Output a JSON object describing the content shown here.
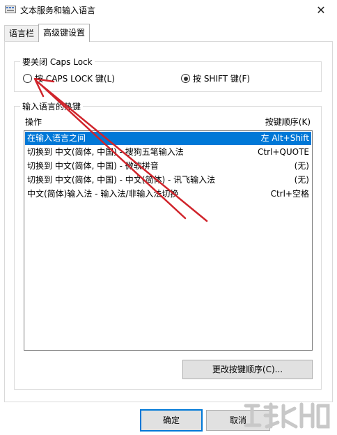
{
  "window": {
    "title": "文本服务和输入语言"
  },
  "tabs": [
    {
      "label": "语言栏"
    },
    {
      "label": "高级键设置"
    }
  ],
  "caps_group": {
    "legend": "要关闭 Caps Lock",
    "option_caps": "按 CAPS LOCK 键(L)",
    "option_shift": "按 SHIFT 键(F)",
    "selected": "option_shift"
  },
  "hotkeys_group": {
    "legend": "输入语言的热键",
    "col_action": "操作",
    "col_key": "按键顺序(K)",
    "rows": [
      {
        "action": "在输入语言之间",
        "key": "左 Alt+Shift",
        "selected": true
      },
      {
        "action": "切换到 中文(简体, 中国) - 搜狗五笔输入法",
        "key": "Ctrl+QUOTE"
      },
      {
        "action": "切换到 中文(简体, 中国) - 微软拼音",
        "key": "(无)"
      },
      {
        "action": "切换到 中文(简体, 中国) - 中文(简体) - 讯飞输入法",
        "key": "(无)"
      },
      {
        "action": "中文(简体)输入法 - 输入法/非输入法切换",
        "key": "Ctrl+空格"
      }
    ],
    "change_button": "更改按键顺序(C)..."
  },
  "footer": {
    "ok": "确定",
    "cancel": "取消"
  },
  "colors": {
    "selection": "#0078d7",
    "annotation_arrow": "#d0242b"
  }
}
